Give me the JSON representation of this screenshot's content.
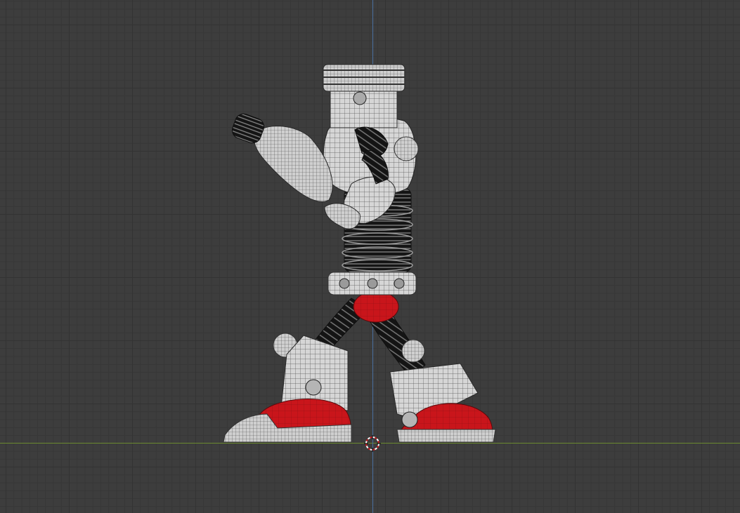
{
  "viewport": {
    "colors": {
      "background": "#3d3d3d",
      "grid_minor": "#373737",
      "grid_major": "#333333",
      "x_axis": "#6c8a2f",
      "z_axis": "#4a6f9e",
      "accent_red": "#c9151b"
    },
    "objects": [
      {
        "name": "robot-character",
        "icon": "robot-icon"
      }
    ],
    "cursor_icon": "3d-cursor-icon"
  }
}
